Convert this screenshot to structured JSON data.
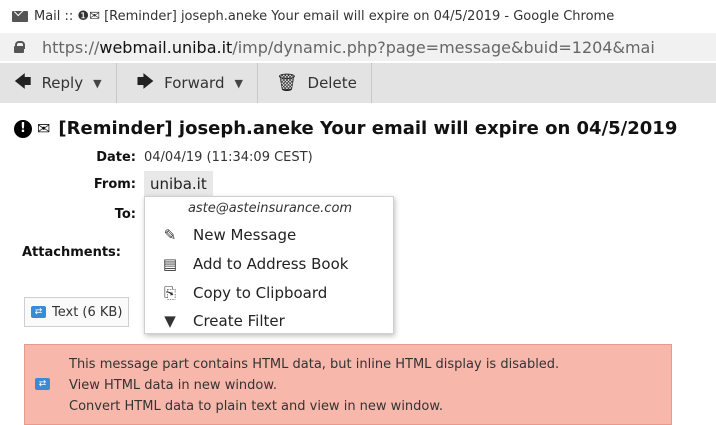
{
  "window": {
    "title": "Mail :: ❶✉ [Reminder] joseph.aneke Your email will expire on 04/5/2019 - Google Chrome"
  },
  "address_bar": {
    "prefix": "https://",
    "domain": "webmail.uniba.it",
    "path": "/imp/dynamic.php?page=message&buid=1204&mai"
  },
  "toolbar": {
    "reply_label": "Reply",
    "forward_label": "Forward",
    "delete_label": "Delete"
  },
  "message": {
    "subject": "[Reminder] joseph.aneke Your email will expire on 04/5/2019",
    "date_label": "Date:",
    "date_value": "04/04/19 (11:34:09 CEST)",
    "from_label": "From:",
    "from_value": "uniba.it",
    "to_label": "To:",
    "attachments_label": "Attachments:"
  },
  "contact_menu": {
    "email": "aste@asteinsurance.com",
    "items": [
      {
        "label": "New Message",
        "icon": "compose-icon"
      },
      {
        "label": "Add to Address Book",
        "icon": "address-book-icon"
      },
      {
        "label": "Copy to Clipboard",
        "icon": "clipboard-icon"
      },
      {
        "label": "Create Filter",
        "icon": "filter-icon"
      }
    ]
  },
  "parts": {
    "text_part_label": "Text (6 KB)"
  },
  "notice": {
    "line1": "This message part contains HTML data, but inline HTML display is disabled.",
    "line2": "View HTML data in new window.",
    "line3": "Convert HTML data to plain text and view in new window.",
    "background_color": "#f7b8ab"
  }
}
